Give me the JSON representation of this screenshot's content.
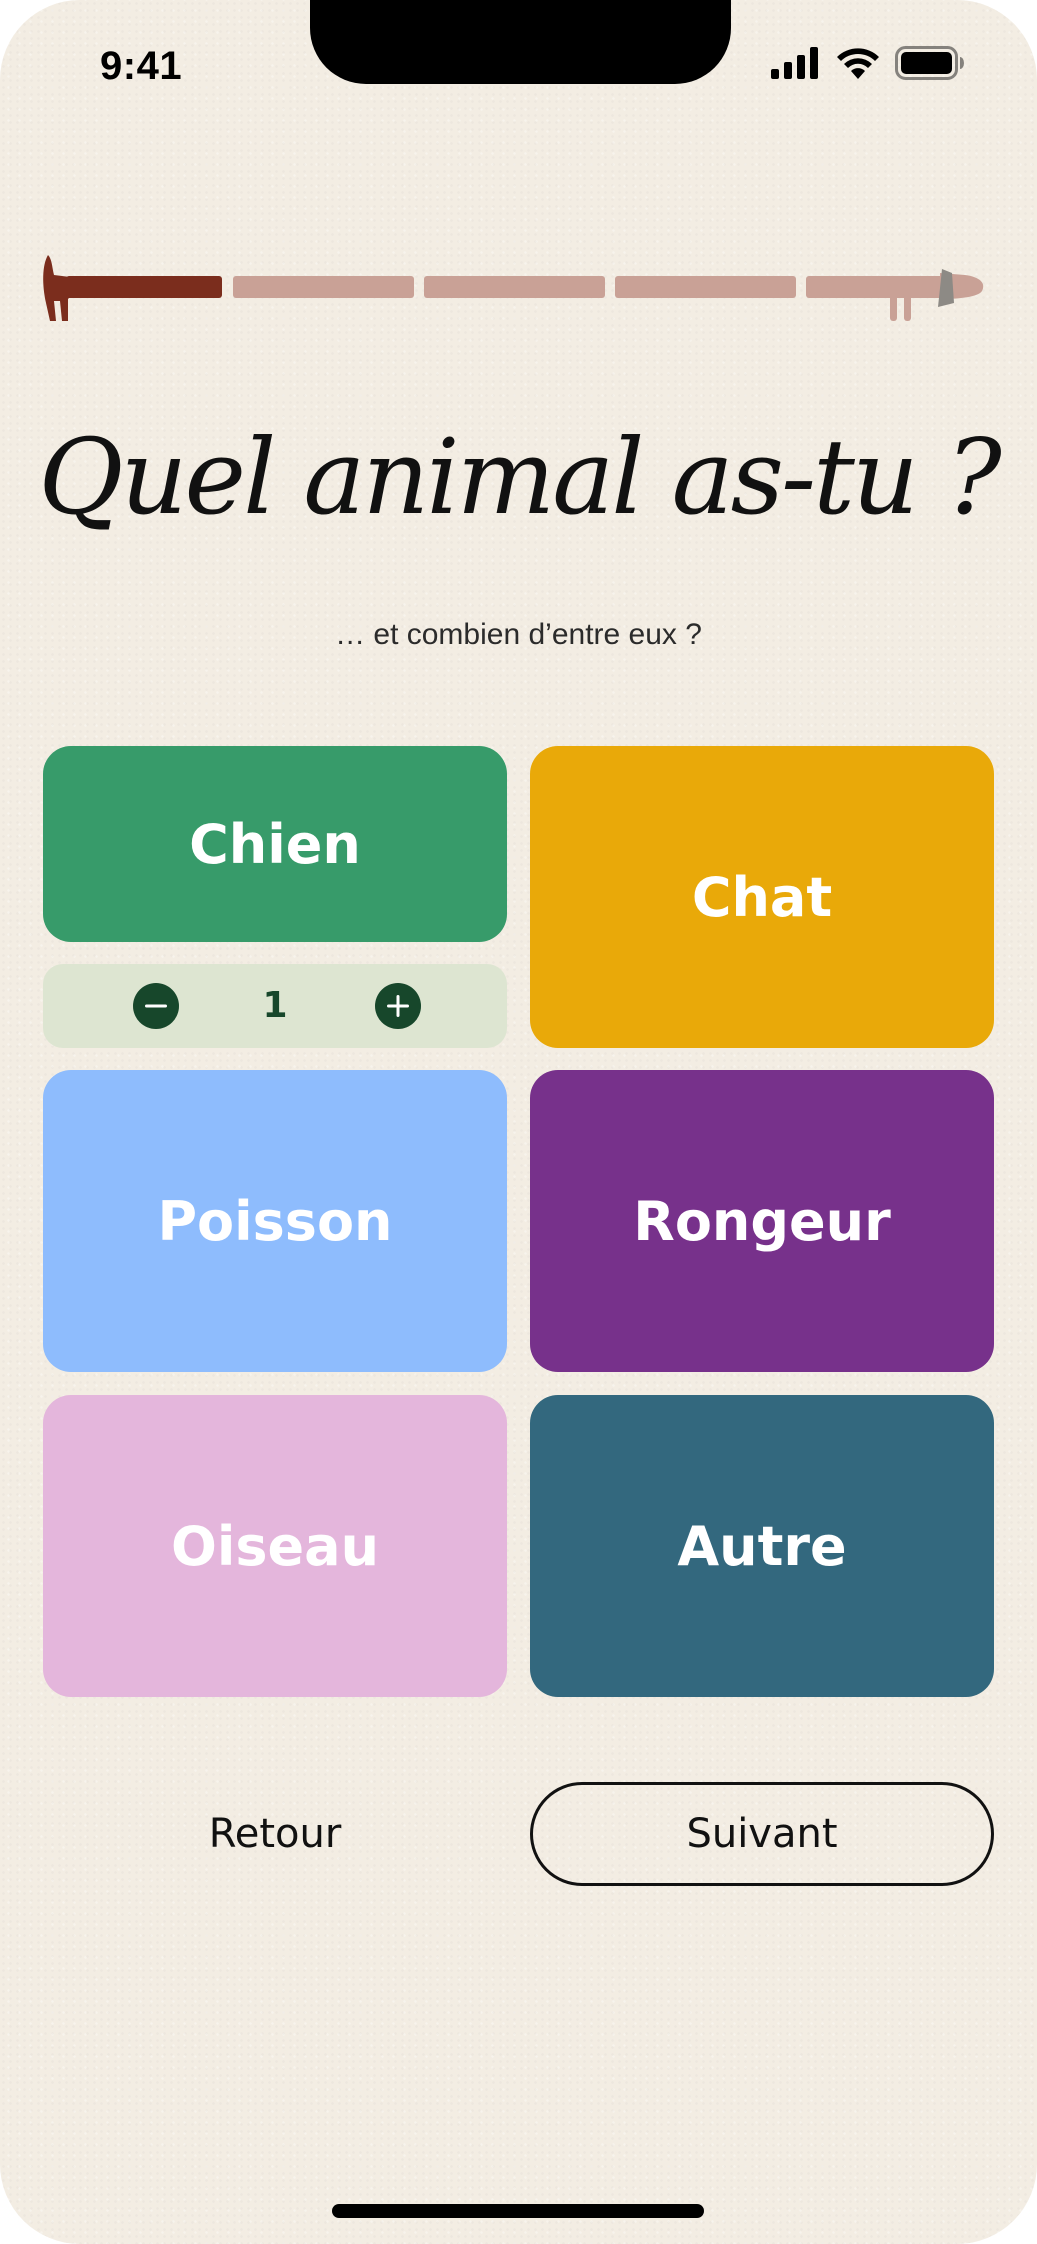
{
  "status_bar": {
    "time": "9:41",
    "icons": [
      "cellular-signal-icon",
      "wifi-icon",
      "battery-icon"
    ]
  },
  "progress": {
    "current_step": 1,
    "total_steps": 5,
    "completed_color": "#7b2d1d",
    "pending_color": "#c9a196",
    "icons": [
      "dog-tail-icon",
      "dog-head-icon"
    ]
  },
  "question": {
    "title": "Quel animal as-tu ?",
    "subtitle": "… et combien d’entre eux ?"
  },
  "animals": {
    "chien": {
      "label": "Chien",
      "color": "#379b6a",
      "selected": true,
      "count": "1"
    },
    "chat": {
      "label": "Chat",
      "color": "#e9a909"
    },
    "poisson": {
      "label": "Poisson",
      "color": "#8ebcfd"
    },
    "rongeur": {
      "label": "Rongeur",
      "color": "#77318b"
    },
    "oiseau": {
      "label": "Oiseau",
      "color": "#e4b6dc"
    },
    "autre": {
      "label": "Autre",
      "color": "#33687e"
    }
  },
  "stepper": {
    "icons": [
      "minus-circle-icon",
      "plus-circle-icon"
    ],
    "color": "#17472b"
  },
  "navigation": {
    "back_label": "Retour",
    "next_label": "Suivant"
  }
}
